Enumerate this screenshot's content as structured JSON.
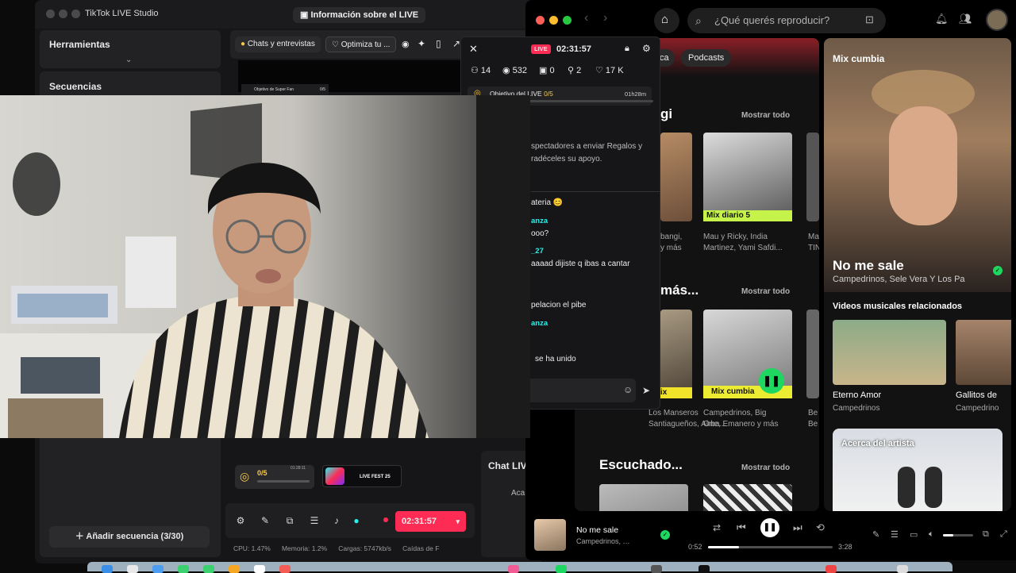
{
  "tiktok": {
    "app_title": "TikTok LIVE Studio",
    "info_button": "Información sobre el LIVE",
    "tools_title": "Herramientas",
    "sequences_title": "Secuencias",
    "add_sequence": "Añadir secuencia (3/30)",
    "tab_chats": "Chats y entrevistas",
    "tab_optimize": "Optimiza tu ...",
    "superfan_chip": "Objetivo de Super Fan",
    "superfan_count": "0/5",
    "goal_count": "0/5",
    "goal_time": "01:28:11",
    "fest_label": "LIVE FEST 25",
    "live_timer": "02:31:57",
    "stats": {
      "cpu": "CPU: 1.47%",
      "memory": "Memoria: 1.2%",
      "load": "Cargas: 5747kb/s",
      "drops": "Caídas de F"
    },
    "chat_live_title": "Chat LIV",
    "chat_live_sub": "Aca"
  },
  "live_chat": {
    "badge": "LIVE",
    "timer": "02:31:57",
    "viewers_now": "14",
    "views": "532",
    "gifts": "0",
    "new_followers": "2",
    "likes": "17 K",
    "goal_text": "Objetivo del LIVE",
    "goal_progress": "0/5",
    "goal_time": "01h28m",
    "info_line1": "spectadores a enviar Regalos y",
    "info_line2": "radéceles su apoyo.",
    "messages": [
      {
        "name": "",
        "text": "ateria 😊"
      },
      {
        "name": "anza",
        "text": "ooo?"
      },
      {
        "name": "_27",
        "text": "aaaad dijiste q ibas a cantar"
      },
      {
        "name": "",
        "text": "pelacion el pibe"
      },
      {
        "name": "anza",
        "text": ""
      },
      {
        "name": "",
        "text": "se ha unido"
      }
    ]
  },
  "spotify": {
    "search_placeholder": "¿Qué querés reproducir?",
    "chips": [
      "ca",
      "Podcasts"
    ],
    "section1": {
      "title": "gi",
      "more": "Mostrar todo"
    },
    "section2": {
      "title": "más...",
      "more": "Mostrar todo"
    },
    "section3": {
      "title": "Escuchado...",
      "more": "Mostrar todo"
    },
    "cards1": [
      {
        "sub": "bangi,\ny más"
      },
      {
        "label": "Mix diario 5",
        "sub": "Mau y Ricky, India\nMartinez, Yami Safdi..."
      },
      {
        "sub": "Ma\nTIN"
      }
    ],
    "cards2": [
      {
        "label": "ix",
        "sub": "Los Manseros\nSantiagueños, Airba..."
      },
      {
        "label": "Mix cumbia",
        "sub": "Campedrinos, Big\nOne, Emanero y más"
      },
      {
        "sub": "Be\nBe"
      }
    ],
    "right": {
      "header": "Mix cumbia",
      "song": "No me sale",
      "artists": "Campedrinos, Sele Vera Y Los Pa",
      "related_title": "Videos musicales relacionados",
      "videos": [
        {
          "title": "Eterno Amor",
          "artist": "Campedrinos"
        },
        {
          "title": "Gallitos de",
          "artist": "Campedrino"
        }
      ],
      "about_artist": "Acerca del artista"
    },
    "now_playing": {
      "title": "No me sale",
      "artist": "Campedrinos, Sele",
      "elapsed": "0:52",
      "total": "3:28",
      "progress": 0.25,
      "volume": 0.35
    }
  },
  "colors": {
    "tiktok_red": "#fe2c55",
    "tiktok_cyan": "#25f4ee",
    "spotify_green": "#1ed760"
  }
}
